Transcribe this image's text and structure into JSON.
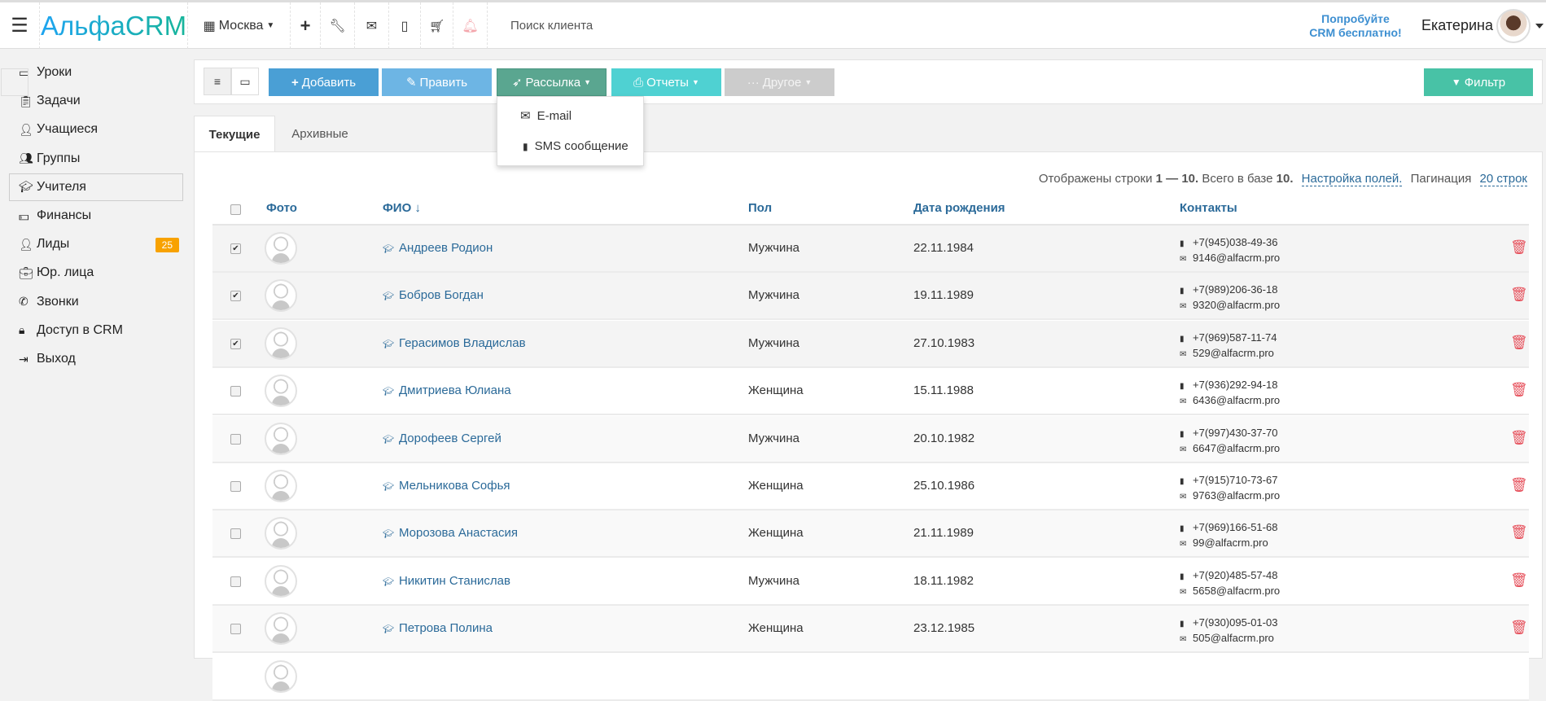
{
  "topbar": {
    "logo": "АльфаCRM",
    "branch": "Москва",
    "search_placeholder": "Поиск клиента",
    "promo_line1": "Попробуйте",
    "promo_line2": "CRM бесплатно!",
    "user": "Екатерина"
  },
  "sidebar": {
    "items": [
      {
        "label": "Уроки",
        "icon": "calendar-icon"
      },
      {
        "label": "Задачи",
        "icon": "clipboard-icon"
      },
      {
        "label": "Учащиеся",
        "icon": "user-icon"
      },
      {
        "label": "Группы",
        "icon": "users-icon"
      },
      {
        "label": "Учителя",
        "icon": "graduation-cap-icon",
        "active": true
      },
      {
        "label": "Финансы",
        "icon": "money-icon"
      },
      {
        "label": "Лиды",
        "icon": "user-plus-icon",
        "badge": "25"
      },
      {
        "label": "Юр. лица",
        "icon": "briefcase-icon"
      },
      {
        "label": "Звонки",
        "icon": "phone-icon"
      },
      {
        "label": "Доступ в CRM",
        "icon": "lock-icon"
      },
      {
        "label": "Выход",
        "icon": "sign-out-icon"
      }
    ]
  },
  "toolbar": {
    "add": "Добавить",
    "edit": "Править",
    "mailing": "Рассылка",
    "reports": "Отчеты",
    "other": "Другое",
    "filter": "Фильтр"
  },
  "mailing_menu": {
    "email": "E-mail",
    "sms": "SMS сообщение"
  },
  "tabs": {
    "current": "Текущие",
    "archived": "Архивные"
  },
  "info": {
    "prefix": "Отображены строки",
    "range": "1 — 10.",
    "total_label": "Всего в базе",
    "total": "10.",
    "settings": "Настройка полей.",
    "pagination_label": "Пагинация",
    "pagination": "20 строк"
  },
  "table": {
    "headers": {
      "photo": "Фото",
      "name": "ФИО ↓",
      "gender": "Пол",
      "birth": "Дата рождения",
      "contacts": "Контакты"
    },
    "rows": [
      {
        "checked": true,
        "name": "Андреев Родион",
        "gender": "Мужчина",
        "birth": "22.11.1984",
        "phone": "+7(945)038-49-36",
        "email": "9146@alfacrm.pro"
      },
      {
        "checked": true,
        "name": "Бобров Богдан",
        "gender": "Мужчина",
        "birth": "19.11.1989",
        "phone": "+7(989)206-36-18",
        "email": "9320@alfacrm.pro"
      },
      {
        "checked": true,
        "name": "Герасимов Владислав",
        "gender": "Мужчина",
        "birth": "27.10.1983",
        "phone": "+7(969)587-11-74",
        "email": "529@alfacrm.pro"
      },
      {
        "checked": false,
        "name": "Дмитриева Юлиана",
        "gender": "Женщина",
        "birth": "15.11.1988",
        "phone": "+7(936)292-94-18",
        "email": "6436@alfacrm.pro"
      },
      {
        "checked": false,
        "name": "Дорофеев Сергей",
        "gender": "Мужчина",
        "birth": "20.10.1982",
        "phone": "+7(997)430-37-70",
        "email": "6647@alfacrm.pro"
      },
      {
        "checked": false,
        "name": "Мельникова Софья",
        "gender": "Женщина",
        "birth": "25.10.1986",
        "phone": "+7(915)710-73-67",
        "email": "9763@alfacrm.pro"
      },
      {
        "checked": false,
        "name": "Морозова Анастасия",
        "gender": "Женщина",
        "birth": "21.11.1989",
        "phone": "+7(969)166-51-68",
        "email": "99@alfacrm.pro"
      },
      {
        "checked": false,
        "name": "Никитин Станислав",
        "gender": "Мужчина",
        "birth": "18.11.1982",
        "phone": "+7(920)485-57-48",
        "email": "5658@alfacrm.pro"
      },
      {
        "checked": false,
        "name": "Петрова Полина",
        "gender": "Женщина",
        "birth": "23.12.1985",
        "phone": "+7(930)095-01-03",
        "email": "505@alfacrm.pro"
      }
    ]
  },
  "colors": {
    "add": "#4a9fd5",
    "edit": "#6db5e4",
    "mailing": "#5aa690",
    "reports": "#4fd1d2",
    "other": "#cccccc",
    "filter": "#48c2a6",
    "link": "#2b6a99",
    "badge": "#f8a200"
  }
}
